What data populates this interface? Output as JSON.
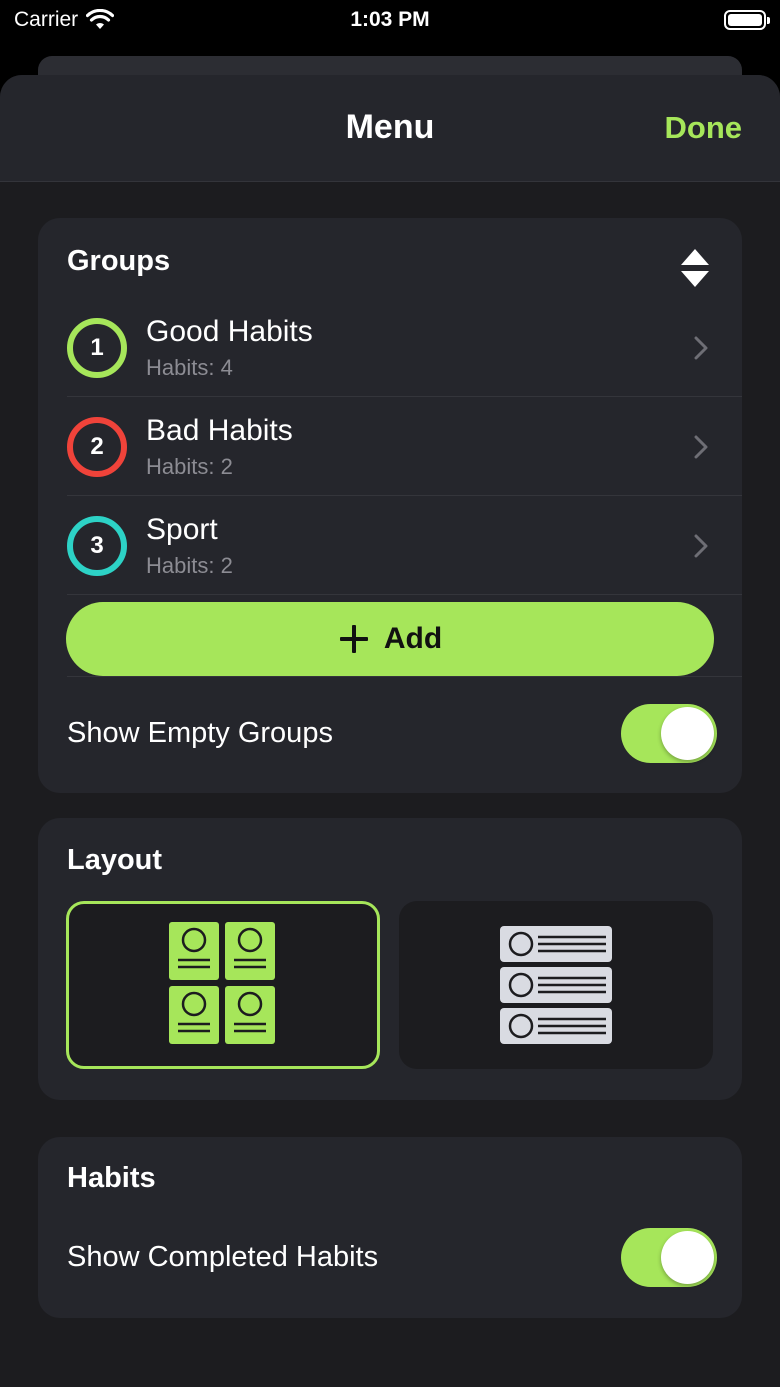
{
  "status_bar": {
    "carrier": "Carrier",
    "time": "1:03 PM"
  },
  "nav": {
    "title": "Menu",
    "done_label": "Done"
  },
  "groups_section": {
    "title": "Groups",
    "items": [
      {
        "number": "1",
        "name": "Good Habits",
        "count": "Habits: 4",
        "color": "#a6e65a"
      },
      {
        "number": "2",
        "name": "Bad Habits",
        "count": "Habits: 2",
        "color": "#f0433a"
      },
      {
        "number": "3",
        "name": "Sport",
        "count": "Habits: 2",
        "color": "#2dd2c6"
      }
    ],
    "add_label": "Add",
    "show_empty_label": "Show Empty Groups",
    "show_empty_on": true
  },
  "layout_section": {
    "title": "Layout",
    "options": [
      "grid",
      "list"
    ],
    "selected": "grid"
  },
  "habits_section": {
    "title": "Habits",
    "show_completed_label": "Show Completed Habits",
    "show_completed_on": true
  },
  "colors": {
    "accent": "#a6e65a",
    "card": "#25262c",
    "background": "#1c1c1f"
  }
}
